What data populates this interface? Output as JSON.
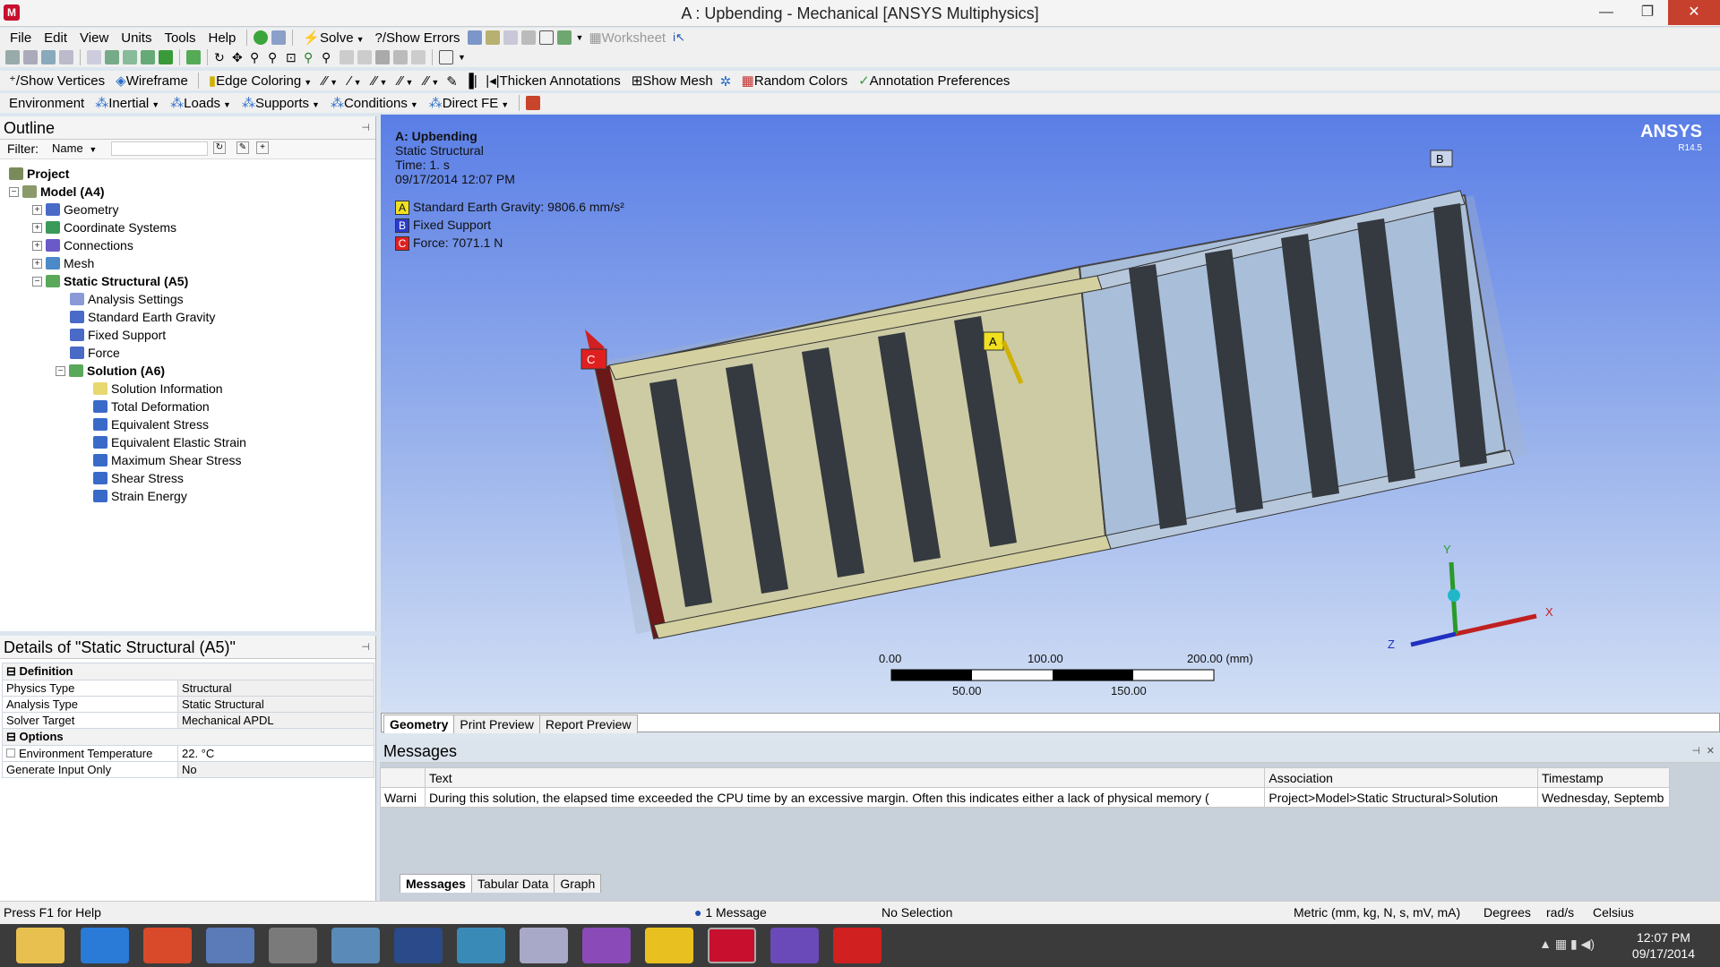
{
  "window": {
    "title": "A : Upbending - Mechanical [ANSYS Multiphysics]"
  },
  "menu": [
    "File",
    "Edit",
    "View",
    "Units",
    "Tools",
    "Help"
  ],
  "toolbar1": {
    "solve": "Solve",
    "show_errors": "Show Errors",
    "worksheet": "Worksheet"
  },
  "toolbar3": {
    "show_vertices": "Show Vertices",
    "wireframe": "Wireframe",
    "edge_coloring": "Edge Coloring",
    "thicken_annotations": "Thicken Annotations",
    "show_mesh": "Show Mesh",
    "random_colors": "Random Colors",
    "annotation_preferences": "Annotation Preferences"
  },
  "toolbar4": {
    "environment": "Environment",
    "inertial": "Inertial",
    "loads": "Loads",
    "supports": "Supports",
    "conditions": "Conditions",
    "direct_fe": "Direct FE"
  },
  "outline": {
    "title": "Outline",
    "filter_label": "Filter:",
    "filter_value": "Name",
    "items": [
      {
        "label": "Project",
        "level": 0,
        "bold": true
      },
      {
        "label": "Model (A4)",
        "level": 1,
        "bold": true
      },
      {
        "label": "Geometry",
        "level": 2
      },
      {
        "label": "Coordinate Systems",
        "level": 2
      },
      {
        "label": "Connections",
        "level": 2
      },
      {
        "label": "Mesh",
        "level": 2
      },
      {
        "label": "Static Structural (A5)",
        "level": 2,
        "bold": true
      },
      {
        "label": "Analysis Settings",
        "level": 3
      },
      {
        "label": "Standard Earth Gravity",
        "level": 3
      },
      {
        "label": "Fixed Support",
        "level": 3
      },
      {
        "label": "Force",
        "level": 3
      },
      {
        "label": "Solution (A6)",
        "level": 3,
        "bold": true
      },
      {
        "label": "Solution Information",
        "level": 4
      },
      {
        "label": "Total Deformation",
        "level": 4
      },
      {
        "label": "Equivalent Stress",
        "level": 4
      },
      {
        "label": "Equivalent Elastic Strain",
        "level": 4
      },
      {
        "label": "Maximum Shear Stress",
        "level": 4
      },
      {
        "label": "Shear Stress",
        "level": 4
      },
      {
        "label": "Strain Energy",
        "level": 4
      }
    ]
  },
  "details": {
    "title": "Details of \"Static Structural (A5)\"",
    "groups": [
      {
        "name": "Definition",
        "rows": [
          [
            "Physics Type",
            "Structural"
          ],
          [
            "Analysis Type",
            "Static Structural"
          ],
          [
            "Solver Target",
            "Mechanical APDL"
          ]
        ]
      },
      {
        "name": "Options",
        "rows": [
          [
            "Environment Temperature",
            "22. °C"
          ],
          [
            "Generate Input Only",
            "No"
          ]
        ]
      }
    ]
  },
  "viewport": {
    "heading": "A: Upbending",
    "subtitle": "Static Structural",
    "time": "Time: 1. s",
    "date": "09/17/2014 12:07 PM",
    "logo": "ANSYS",
    "version": "R14.5",
    "legend": [
      {
        "key": "A",
        "text": "Standard Earth Gravity: 9806.6 mm/s²",
        "color": "#f0e020"
      },
      {
        "key": "B",
        "text": "Fixed Support",
        "color": "#2a3cc8"
      },
      {
        "key": "C",
        "text": "Force: 7071.1 N",
        "color": "#e02020"
      }
    ],
    "scale": {
      "top": [
        "0.00",
        "100.00",
        "200.00 (mm)"
      ],
      "bottom": [
        "50.00",
        "150.00"
      ]
    },
    "axes": {
      "x": "X",
      "y": "Y",
      "z": "Z"
    },
    "tabs": [
      "Geometry",
      "Print Preview",
      "Report Preview"
    ]
  },
  "messages": {
    "title": "Messages",
    "columns": [
      "",
      "Text",
      "Association",
      "Timestamp"
    ],
    "rows": [
      [
        "Warni",
        "During this solution, the elapsed time exceeded the CPU time by an excessive margin.  Often this indicates either a lack of physical memory (",
        "Project>Model>Static Structural>Solution",
        "Wednesday, Septemb"
      ]
    ],
    "tabs": [
      "Messages",
      "Tabular Data",
      "Graph"
    ]
  },
  "status": {
    "help": "Press F1 for Help",
    "messages": "1 Message",
    "selection": "No Selection",
    "units": "Metric (mm, kg, N, s, mV, mA)",
    "angle": "Degrees",
    "rot": "rad/s",
    "temp": "Celsius"
  },
  "taskbar": {
    "time": "12:07 PM",
    "date": "09/17/2014"
  }
}
